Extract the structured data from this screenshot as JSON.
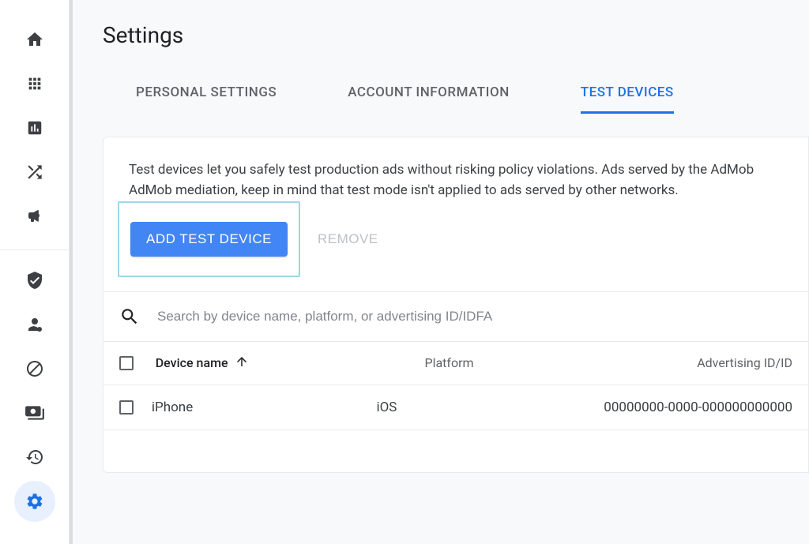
{
  "page": {
    "title": "Settings"
  },
  "tabs": [
    {
      "label": "PERSONAL SETTINGS"
    },
    {
      "label": "ACCOUNT INFORMATION"
    },
    {
      "label": "TEST DEVICES"
    }
  ],
  "panel": {
    "description": "Test devices let you safely test production ads without risking policy violations. Ads served by the AdMob AdMob mediation, keep in mind that test mode isn't applied to ads served by other networks.",
    "add_button": "ADD TEST DEVICE",
    "remove_button": "REMOVE",
    "search_placeholder": "Search by device name, platform, or advertising ID/IDFA"
  },
  "table": {
    "headers": {
      "device_name": "Device name",
      "platform": "Platform",
      "advertising_id": "Advertising ID/ID"
    },
    "rows": [
      {
        "name": "iPhone",
        "platform": "iOS",
        "id": "00000000-0000-000000000000"
      }
    ]
  }
}
